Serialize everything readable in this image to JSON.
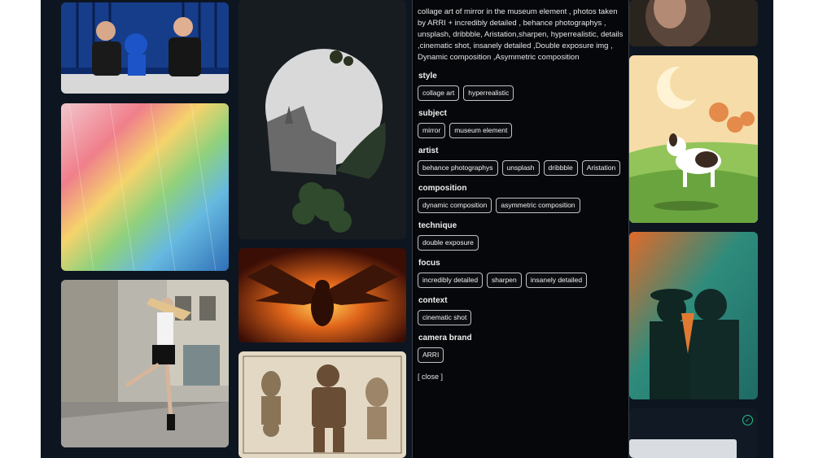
{
  "prompt": {
    "text": "collage art of mirror in the museum element , photos taken by ARRI + incredibly detailed , behance photographys , unsplash, dribbble, Aristation,sharpen, hyperrealistic, details ,cinematic shot, insanely detailed ,Double exposure img , Dynamic composition ,Asymmetric composition"
  },
  "sections": [
    {
      "title": "style",
      "chips": [
        "collage art",
        "hyperrealistic"
      ]
    },
    {
      "title": "subject",
      "chips": [
        "mirror",
        "museum element"
      ]
    },
    {
      "title": "artist",
      "chips": [
        "behance photographys",
        "unsplash",
        "dribbble",
        "Aristation"
      ]
    },
    {
      "title": "composition",
      "chips": [
        "dynamic composition",
        "asymmetric composition"
      ]
    },
    {
      "title": "technique",
      "chips": [
        "double exposure"
      ]
    },
    {
      "title": "focus",
      "chips": [
        "incredibly detailed",
        "sharpen",
        "insanely detailed"
      ]
    },
    {
      "title": "context",
      "chips": [
        "cinematic shot"
      ]
    },
    {
      "title": "camera brand",
      "chips": [
        "ARRI"
      ]
    }
  ],
  "close_label": "[ close ]",
  "status_icon": "check-circle-icon",
  "colors": {
    "accent": "#22c58b",
    "background": "#0d1520"
  }
}
